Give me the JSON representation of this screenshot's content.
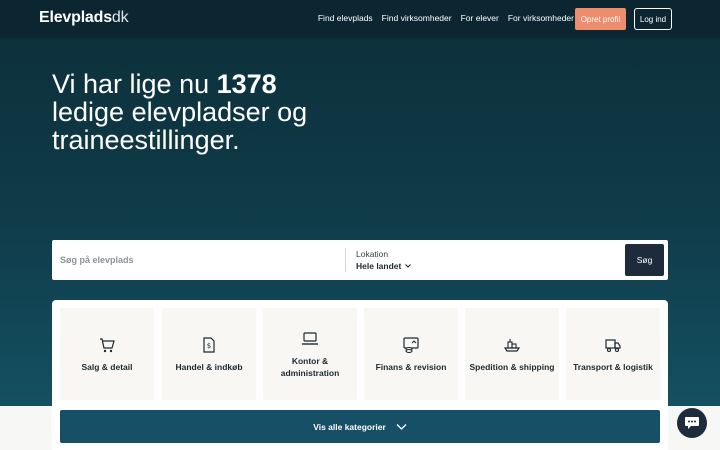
{
  "header": {
    "logo_main": "Elevplads",
    "logo_suffix": "dk",
    "nav": [
      "Find elevplads",
      "Find virksomheder",
      "For elever",
      "For virksomheder"
    ],
    "signup_label": "Opret profil",
    "login_label": "Log ind"
  },
  "hero": {
    "title_pre": "Vi har lige nu ",
    "count": "1378",
    "title_post": " ledige elevpladser og traineestillinger."
  },
  "search": {
    "placeholder": "Søg på elevplads",
    "location_label": "Lokation",
    "location_value": "Hele landet",
    "button_label": "Søg"
  },
  "categories": {
    "items": [
      {
        "label": "Salg & detail",
        "icon": "shopping-cart-icon"
      },
      {
        "label": "Handel & indkøb",
        "icon": "receipt-icon"
      },
      {
        "label": "Kontor & administration",
        "icon": "laptop-icon"
      },
      {
        "label": "Finans & revision",
        "icon": "finance-icon"
      },
      {
        "label": "Spedition & shipping",
        "icon": "ship-icon"
      },
      {
        "label": "Transport & logistik",
        "icon": "truck-icon"
      }
    ],
    "show_all_label": "Vis alle kategorier"
  },
  "colors": {
    "header_bg": "#0b2630",
    "accent": "#ee8c6e",
    "primary_button": "#1d2b3c",
    "category_button": "#165066"
  }
}
